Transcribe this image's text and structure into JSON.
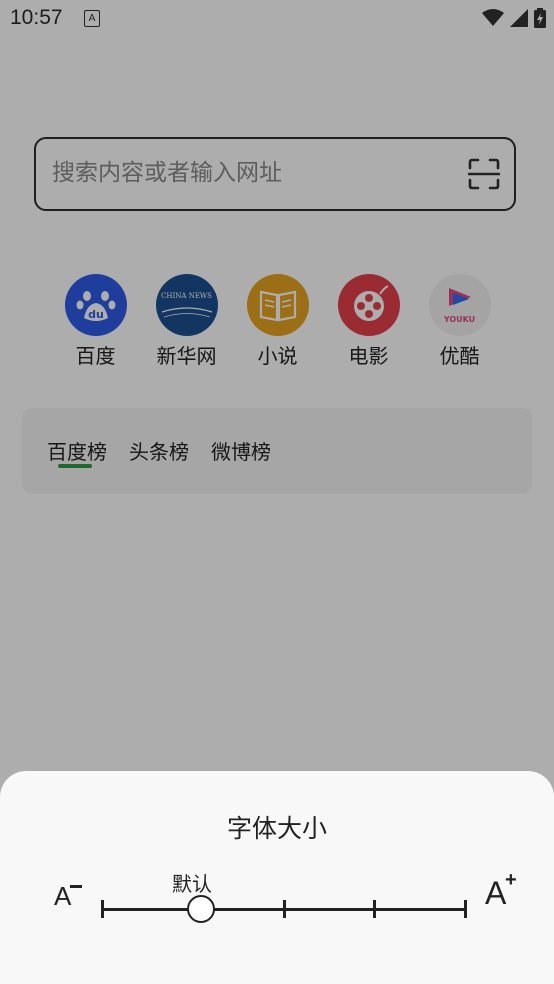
{
  "status_bar": {
    "time": "10:57",
    "notification_letter": "A"
  },
  "search": {
    "placeholder": "搜索内容或者输入网址"
  },
  "quick_links": [
    {
      "label": "百度",
      "icon": "baidu-icon",
      "color": "#2e5be6"
    },
    {
      "label": "新华网",
      "icon": "xinhua-icon",
      "color": "#1d4f91",
      "icon_text": "CHINA NEWS"
    },
    {
      "label": "小说",
      "icon": "book-icon",
      "color": "#e6a21f"
    },
    {
      "label": "电影",
      "icon": "film-reel-icon",
      "color": "#e5404a"
    },
    {
      "label": "优酷",
      "icon": "youku-icon",
      "color": "#f2f2f2",
      "icon_text": "YOUKU"
    }
  ],
  "rank_tabs": {
    "items": [
      "百度榜",
      "头条榜",
      "微博榜"
    ],
    "selected": "百度榜",
    "indicator_color": "#2f9a48"
  },
  "font_sheet": {
    "title": "字体大小",
    "smaller_label": "A",
    "larger_label": "A",
    "larger_sign": "+",
    "current_value": "默认",
    "steps": 5,
    "selected_step": 2
  }
}
